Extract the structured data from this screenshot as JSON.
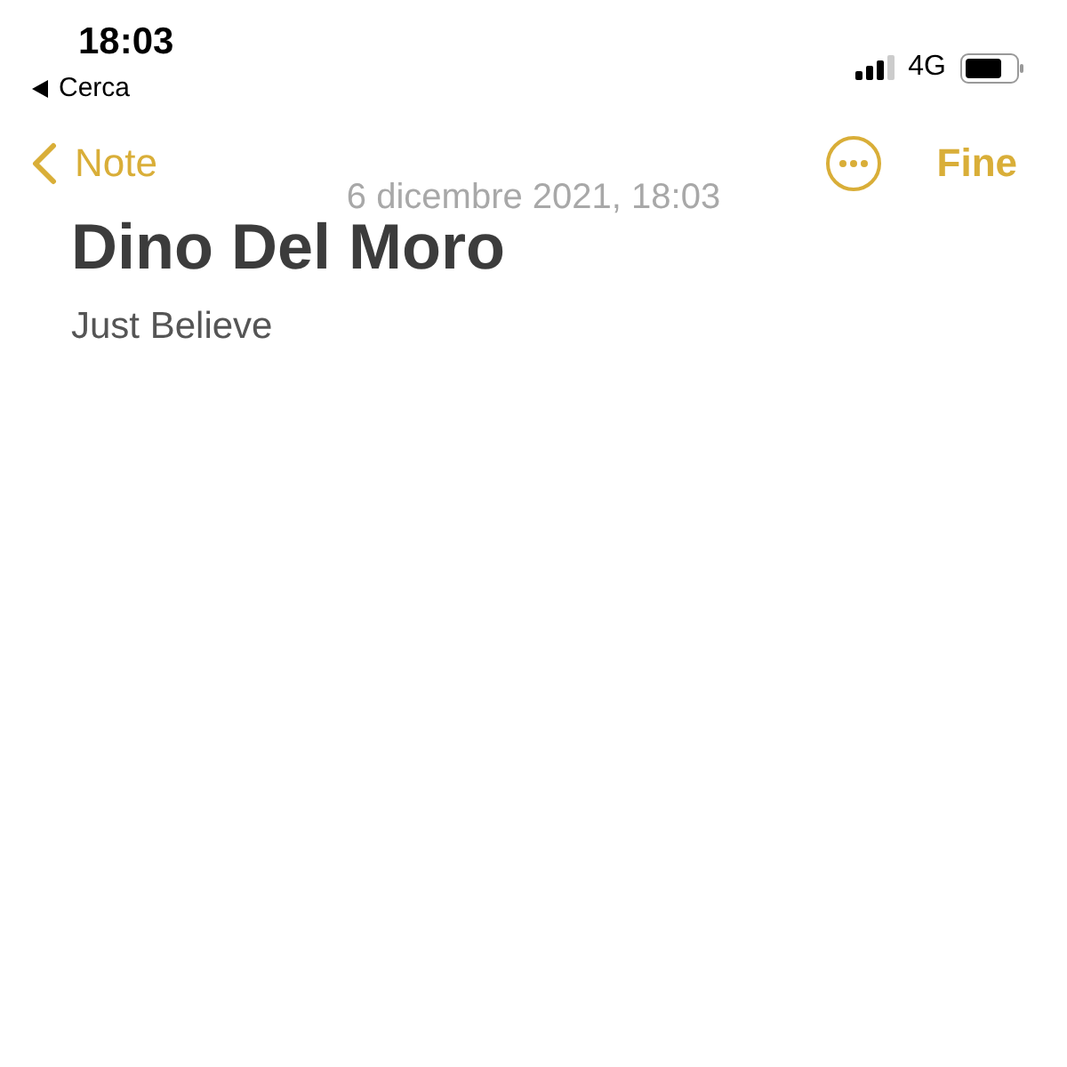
{
  "status_bar": {
    "time": "18:03",
    "back_app": "Cerca",
    "network": "4G"
  },
  "nav": {
    "back": "Note",
    "done": "Fine"
  },
  "note": {
    "date": "6 dicembre 2021, 18:03",
    "title": "Dino Del Moro",
    "body": "Just Believe"
  }
}
